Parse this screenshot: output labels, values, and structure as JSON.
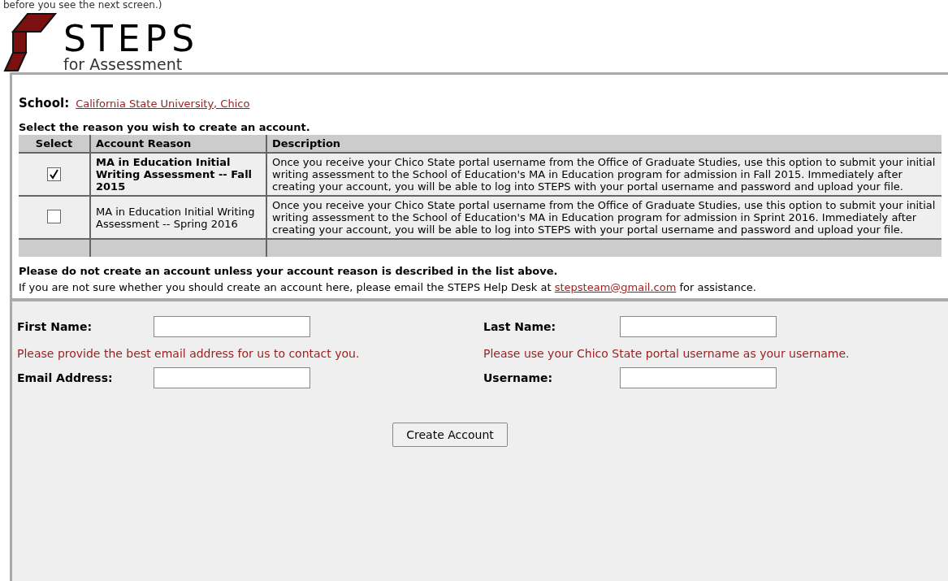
{
  "top_note": "before you see the next screen.)",
  "logo": {
    "title": "STEPS",
    "subtitle": "for Assessment"
  },
  "school": {
    "label": "School:",
    "value": "California State University, Chico"
  },
  "instruction": "Select the reason you wish to create an account.",
  "table": {
    "columns": [
      "Select",
      "Account Reason",
      "Description"
    ],
    "rows": [
      {
        "selected": true,
        "reason": "MA in Education Initial Writing Assessment -- Fall 2015",
        "description": "Once you receive your Chico State portal username from the Office of Graduate Studies, use this option to submit your initial writing assessment to the School of Education's MA in Education program for admission in Fall 2015. Immediately after creating your account, you will be able to log into STEPS with your portal username and password and upload your file."
      },
      {
        "selected": false,
        "reason": "MA in Education Initial Writing Assessment -- Spring 2016",
        "description": "Once you receive your Chico State portal username from the Office of Graduate Studies, use this option to submit your initial writing assessment to the School of Education's MA in Education program for admission in Sprint 2016. Immediately after creating your account, you will be able to log into STEPS with your portal username and password and upload your file."
      }
    ]
  },
  "warning": "Please do not create an account unless your account reason is described in the list above.",
  "help": {
    "before": "If you are not sure whether you should create an account here, please email the STEPS Help Desk at",
    "link": "stepsteam@gmail.com",
    "after": "for assistance."
  },
  "form": {
    "left": {
      "first_label": "First Name:",
      "hint": "Please provide the best email address for us to contact you.",
      "second_label": "Email Address:"
    },
    "right": {
      "first_label": "Last Name:",
      "hint": "Please use your Chico State portal username as your username.",
      "second_label": "Username:"
    },
    "submit": "Create Account"
  }
}
